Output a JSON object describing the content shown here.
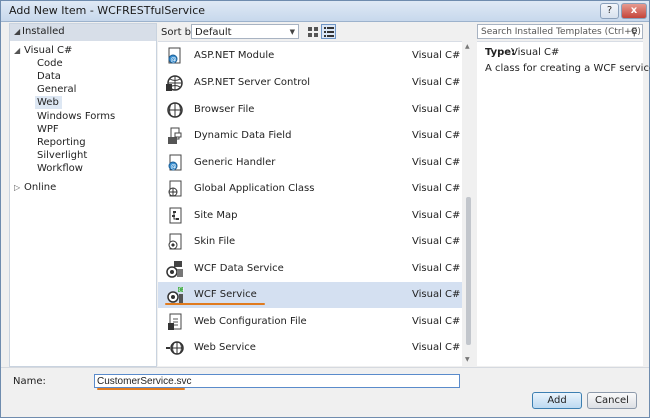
{
  "window": {
    "title": "Add New Item - WCFRESTfulService",
    "help_label": "?",
    "close_label": "x"
  },
  "left_tree": {
    "header": "Installed",
    "items": [
      {
        "label": "Visual C#",
        "level": 0,
        "expanded": true
      },
      {
        "label": "Code",
        "level": 1
      },
      {
        "label": "Data",
        "level": 1
      },
      {
        "label": "General",
        "level": 1
      },
      {
        "label": "Web",
        "level": 1,
        "selected": true
      },
      {
        "label": "Windows Forms",
        "level": 1
      },
      {
        "label": "WPF",
        "level": 1
      },
      {
        "label": "Reporting",
        "level": 1
      },
      {
        "label": "Silverlight",
        "level": 1
      },
      {
        "label": "Workflow",
        "level": 1
      },
      {
        "label": "Online",
        "level": 0,
        "expanded": false
      }
    ]
  },
  "sortbar": {
    "label": "Sort by:",
    "value": "Default"
  },
  "search": {
    "placeholder": "Search Installed Templates (Ctrl+E)",
    "icon": "search-icon"
  },
  "templates": [
    {
      "name": "ASP.NET Module",
      "category": "Visual C#",
      "icon": "aspnet-module-icon"
    },
    {
      "name": "ASP.NET Server Control",
      "category": "Visual C#",
      "icon": "server-control-icon"
    },
    {
      "name": "Browser File",
      "category": "Visual C#",
      "icon": "browser-file-icon"
    },
    {
      "name": "Dynamic Data Field",
      "category": "Visual C#",
      "icon": "dynamic-data-icon"
    },
    {
      "name": "Generic Handler",
      "category": "Visual C#",
      "icon": "generic-handler-icon"
    },
    {
      "name": "Global Application Class",
      "category": "Visual C#",
      "icon": "global-app-icon"
    },
    {
      "name": "Site Map",
      "category": "Visual C#",
      "icon": "site-map-icon"
    },
    {
      "name": "Skin File",
      "category": "Visual C#",
      "icon": "skin-file-icon"
    },
    {
      "name": "WCF Data Service",
      "category": "Visual C#",
      "icon": "wcf-data-service-icon"
    },
    {
      "name": "WCF Service",
      "category": "Visual C#",
      "icon": "wcf-service-icon",
      "selected": true
    },
    {
      "name": "Web Configuration File",
      "category": "Visual C#",
      "icon": "web-config-icon"
    },
    {
      "name": "Web Service",
      "category": "Visual C#",
      "icon": "web-service-icon"
    }
  ],
  "details": {
    "type_label": "Type:",
    "type_value": "Visual C#",
    "description": "A class for creating a WCF service"
  },
  "name_field": {
    "label": "Name:",
    "value": "CustomerService.svc"
  },
  "buttons": {
    "add": "Add",
    "cancel": "Cancel"
  },
  "colors": {
    "accent": "#e07b1f",
    "selection": "#d4e0f1"
  }
}
